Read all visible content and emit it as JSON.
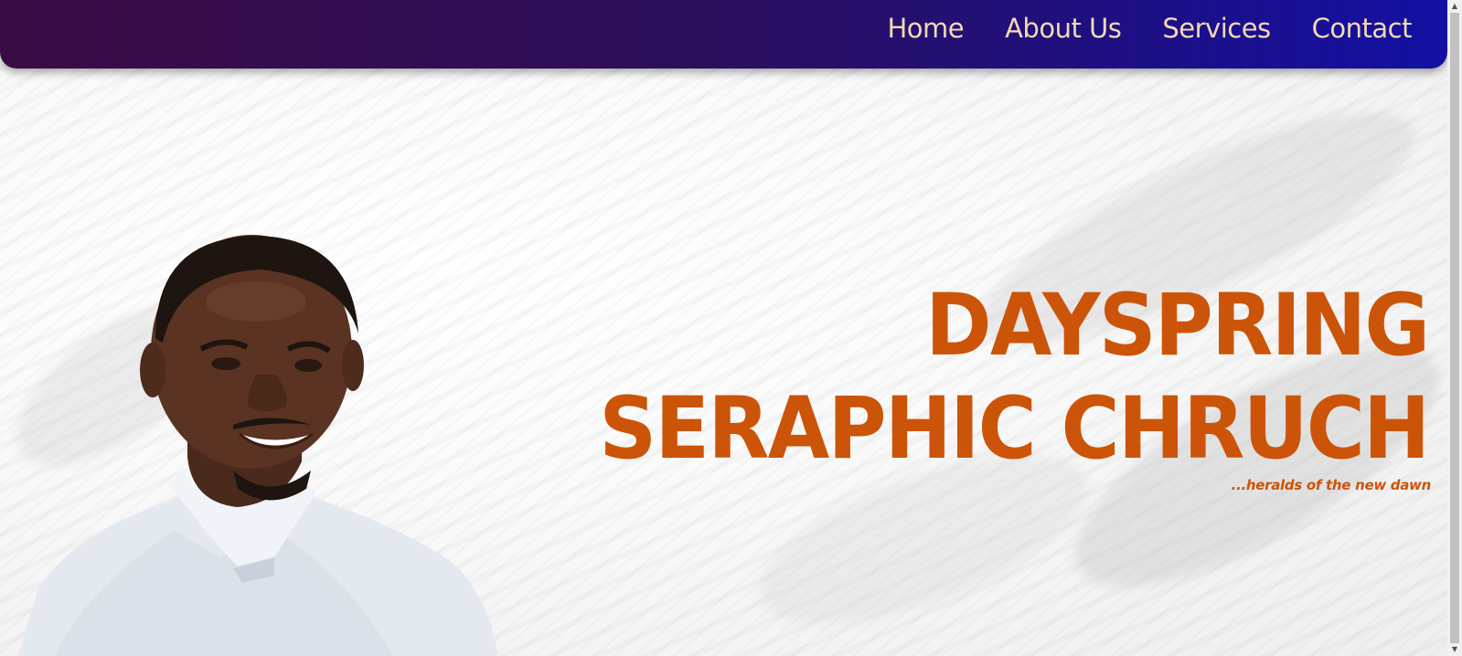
{
  "nav": {
    "items": [
      {
        "label": "Home"
      },
      {
        "label": "About Us"
      },
      {
        "label": "Services"
      },
      {
        "label": "Contact"
      }
    ]
  },
  "hero": {
    "title_line1": "DAYSPRING",
    "title_line2": "SERAPHIC CHRUCH",
    "tagline": "...heralds of the new dawn"
  },
  "colors": {
    "accent": "#cc5408",
    "nav_start": "#3a0c44",
    "nav_end": "#1310a3",
    "nav_text": "#f3d9b4"
  }
}
